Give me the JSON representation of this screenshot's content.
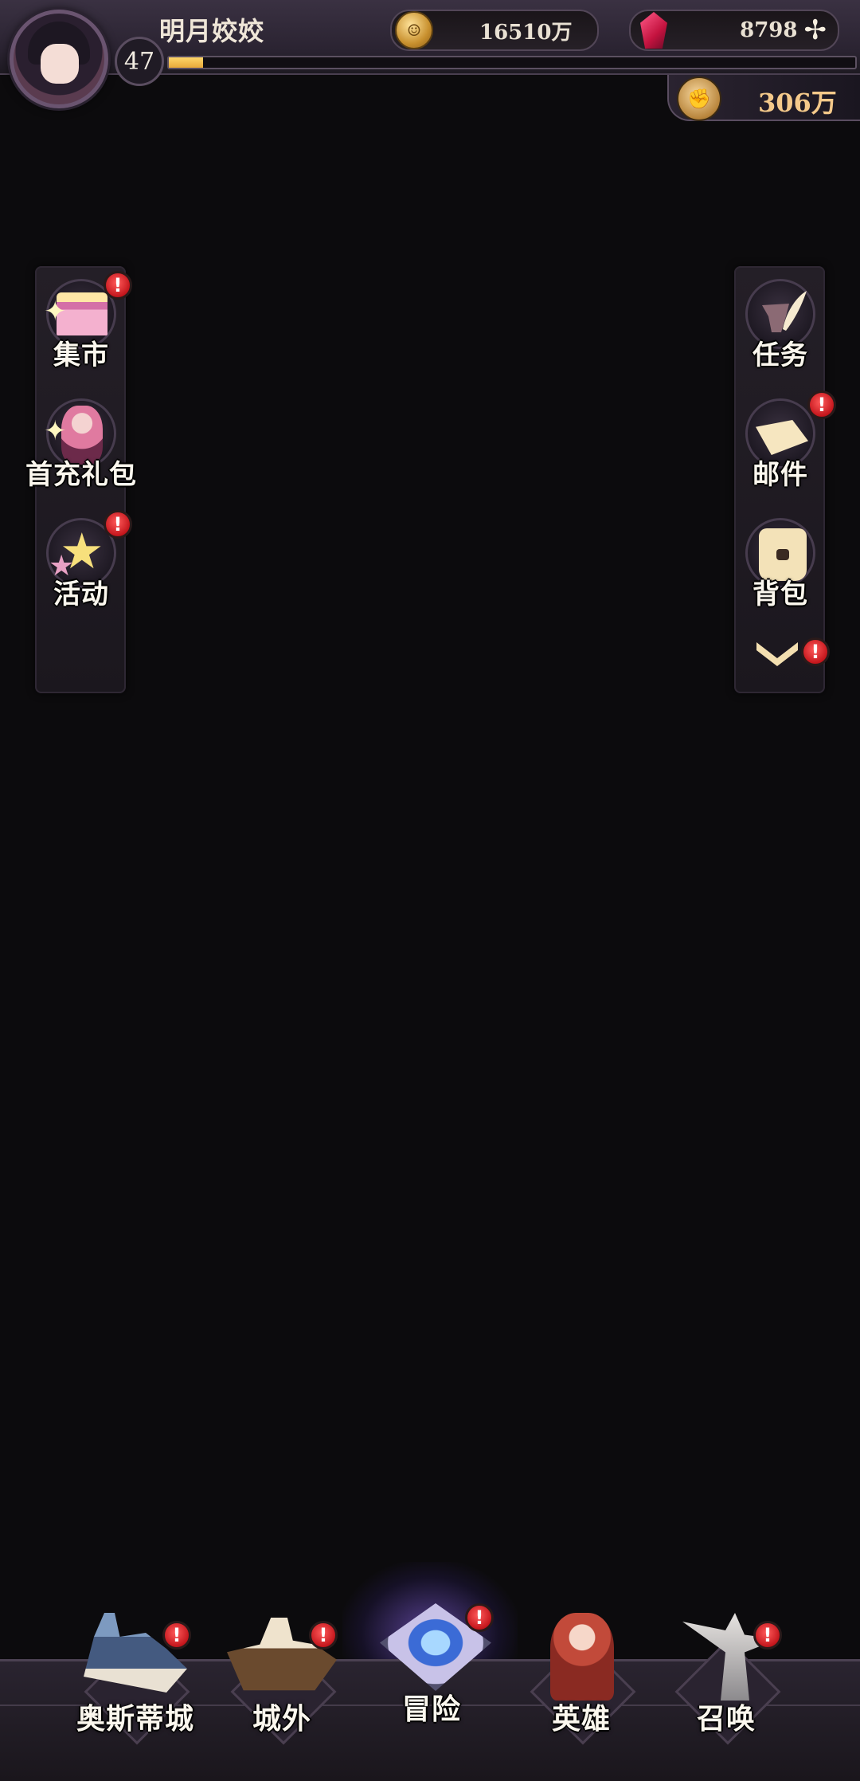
{
  "player": {
    "name": "明月姣姣",
    "level": "47",
    "exp_fraction": 0.05
  },
  "currencies": {
    "gold": "16510万",
    "gems": "8798",
    "power": "306万"
  },
  "left_menu": [
    {
      "label": "集市",
      "icon": "market-icon",
      "alert": "!"
    },
    {
      "label": "首充礼包",
      "icon": "gift-girl-icon",
      "alert": ""
    },
    {
      "label": "活动",
      "icon": "star-icon",
      "alert": "!"
    }
  ],
  "right_menu": [
    {
      "label": "任务",
      "icon": "quill-icon",
      "alert": ""
    },
    {
      "label": "邮件",
      "icon": "mail-icon",
      "alert": "!"
    },
    {
      "label": "背包",
      "icon": "bag-icon",
      "alert": ""
    }
  ],
  "expand_alert": "!",
  "bottom_nav": [
    {
      "label": "奥斯蒂城",
      "icon": "city-icon",
      "alert": "!"
    },
    {
      "label": "城外",
      "icon": "ship-icon",
      "alert": "!"
    },
    {
      "label": "冒险",
      "icon": "portal-icon",
      "alert": "!"
    },
    {
      "label": "英雄",
      "icon": "hero-icon",
      "alert": ""
    },
    {
      "label": "召唤",
      "icon": "statue-icon",
      "alert": "!"
    }
  ],
  "colors": {
    "background": "#0c0b0d",
    "exp_fill": "#f0b84a",
    "alert_red": "#c4161c",
    "power_text": "#f4c98a"
  }
}
